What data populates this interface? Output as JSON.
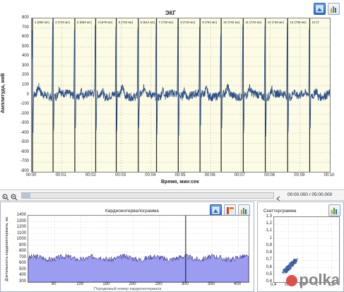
{
  "ecg": {
    "title": "ЭКГ",
    "ylabel": "Амплитуда, мкВ",
    "xlabel": "Время, мин:сек",
    "y_ticks": [
      "800",
      "700",
      "600",
      "500",
      "400",
      "300",
      "200",
      "100",
      "0",
      "-100",
      "-200",
      "-300",
      "-400",
      "-500",
      "-600",
      "-700",
      "-800"
    ],
    "x_ticks": [
      "00:00",
      "00:01",
      "00:02",
      "00:03",
      "00:04",
      "00:05",
      "00:06",
      "00:07",
      "00:08",
      "00:09",
      "00:10"
    ],
    "beat_labels": [
      "1 (692 мс)",
      "2 (733 мс)",
      "3 (694 мс)",
      "4 (678 мс)",
      "5 (734 мс)",
      "6 (614 мс)",
      "7 (730 мс)",
      "8 (734 мс)",
      "9 (704 мс)",
      "10 (742 мс)",
      "11 (744 мс)",
      "12 (746 мс)",
      "13 (736 мс)",
      "14 (7"
    ],
    "line_color": "#2e4f86"
  },
  "nav": {
    "zoom_in": "+",
    "zoom_out": "−",
    "time_readout": "00:00.000 / 05:00.000"
  },
  "rhythmogram": {
    "title": "Кардиоинтервалограмма",
    "ylabel": "Длительность кардиоинтервала, мс",
    "xlabel": "Порядковый номер кардиоинтервала",
    "y_ticks": [
      "1400",
      "1300",
      "1200",
      "1100",
      "1000",
      "900",
      "800",
      "700",
      "600",
      "500",
      "400",
      "300"
    ],
    "x_ticks": [
      "50",
      "100",
      "150",
      "200",
      "250",
      "300",
      "350",
      "400"
    ],
    "fill_color": "#9c9cf0"
  },
  "scattergram": {
    "title": "Скаттерграмма",
    "y_ticks": [
      "1,3",
      "1,2",
      "1,1",
      "1",
      "0,9",
      "0,8",
      "0,7",
      "0,6",
      "0,5",
      "0,4"
    ],
    "x_ticks": [
      "0,4",
      "0,6",
      "0,8",
      "1",
      "1,2"
    ],
    "point_color": "#3d5f9e"
  },
  "watermark": "polka",
  "chart_data": [
    {
      "type": "line",
      "title": "ЭКГ",
      "xlabel": "Время, мин:сек",
      "ylabel": "Амплитуда, мкВ",
      "ylim": [
        -800,
        800
      ],
      "x_range": [
        "00:00",
        "00:10"
      ],
      "grid": true,
      "beat_times_s": [
        0.0,
        0.69,
        1.42,
        2.12,
        2.81,
        3.55,
        4.16,
        4.89,
        5.62,
        6.33,
        7.07,
        7.81,
        8.56,
        9.3
      ]
    },
    {
      "type": "area",
      "title": "Кардиоинтервалограмма",
      "xlabel": "Порядковый номер кардиоинтервала",
      "ylabel": "Длительность кардиоинтервала, мс",
      "ylim": [
        300,
        1400
      ],
      "xlim": [
        0,
        420
      ],
      "grid": true
    },
    {
      "type": "scatter",
      "title": "Скаттерграмма",
      "xlim": [
        0.4,
        1.3
      ],
      "ylim": [
        0.4,
        1.3
      ],
      "grid": true
    }
  ]
}
